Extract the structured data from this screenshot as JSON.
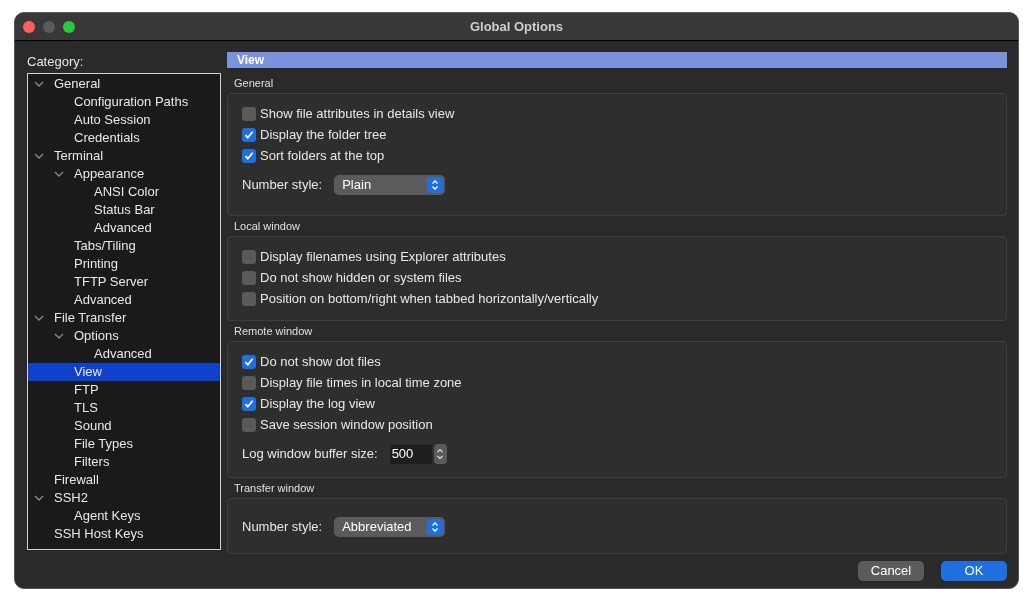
{
  "window": {
    "title": "Global Options"
  },
  "category": {
    "label": "Category:",
    "tree": [
      {
        "label": "General",
        "expanded": true,
        "selected": false,
        "children": [
          {
            "label": "Configuration Paths",
            "selected": false
          },
          {
            "label": "Auto Session",
            "selected": false
          },
          {
            "label": "Credentials",
            "selected": false
          }
        ]
      },
      {
        "label": "Terminal",
        "expanded": true,
        "selected": false,
        "children": [
          {
            "label": "Appearance",
            "expanded": true,
            "selected": false,
            "children": [
              {
                "label": "ANSI Color",
                "selected": false
              },
              {
                "label": "Status Bar",
                "selected": false
              },
              {
                "label": "Advanced",
                "selected": false
              }
            ]
          },
          {
            "label": "Tabs/Tiling",
            "selected": false
          },
          {
            "label": "Printing",
            "selected": false
          },
          {
            "label": "TFTP Server",
            "selected": false
          },
          {
            "label": "Advanced",
            "selected": false
          }
        ]
      },
      {
        "label": "File Transfer",
        "expanded": true,
        "selected": false,
        "children": [
          {
            "label": "Options",
            "expanded": true,
            "selected": false,
            "children": [
              {
                "label": "Advanced",
                "selected": false
              }
            ]
          },
          {
            "label": "View",
            "selected": true
          },
          {
            "label": "FTP",
            "selected": false
          },
          {
            "label": "TLS",
            "selected": false
          },
          {
            "label": "Sound",
            "selected": false
          },
          {
            "label": "File Types",
            "selected": false
          },
          {
            "label": "Filters",
            "selected": false
          }
        ]
      },
      {
        "label": "Firewall",
        "selected": false
      },
      {
        "label": "SSH2",
        "expanded": true,
        "selected": false,
        "children": [
          {
            "label": "Agent Keys",
            "selected": false
          }
        ]
      },
      {
        "label": "SSH Host Keys",
        "selected": false
      }
    ]
  },
  "panel": {
    "title": "View",
    "sections": [
      {
        "title": "General",
        "items": [
          {
            "kind": "checkbox",
            "label": "Show file attributes in details view",
            "checked": false
          },
          {
            "kind": "checkbox",
            "label": "Display the folder tree",
            "checked": true
          },
          {
            "kind": "checkbox",
            "label": "Sort folders at the top",
            "checked": true
          },
          {
            "kind": "select",
            "label": "Number style:",
            "value": "Plain"
          }
        ]
      },
      {
        "title": "Local window",
        "items": [
          {
            "kind": "checkbox",
            "label": "Display filenames using Explorer attributes",
            "checked": false
          },
          {
            "kind": "checkbox",
            "label": "Do not show hidden or system files",
            "checked": false
          },
          {
            "kind": "checkbox",
            "label": "Position on bottom/right when tabbed horizontally/vertically",
            "checked": false
          }
        ]
      },
      {
        "title": "Remote window",
        "items": [
          {
            "kind": "checkbox",
            "label": "Do not show dot files",
            "checked": true
          },
          {
            "kind": "checkbox",
            "label": "Display file times in local time zone",
            "checked": false
          },
          {
            "kind": "checkbox",
            "label": "Display the log view",
            "checked": true
          },
          {
            "kind": "checkbox",
            "label": "Save session window position",
            "checked": false
          },
          {
            "kind": "spinner",
            "label": "Log window buffer size:",
            "value": "500"
          }
        ]
      },
      {
        "title": "Transfer window",
        "items": [
          {
            "kind": "select",
            "label": "Number style:",
            "value": "Abbreviated"
          }
        ]
      }
    ]
  },
  "buttons": [
    {
      "label": "Cancel",
      "kind": "secondary"
    },
    {
      "label": "OK",
      "kind": "primary"
    }
  ]
}
